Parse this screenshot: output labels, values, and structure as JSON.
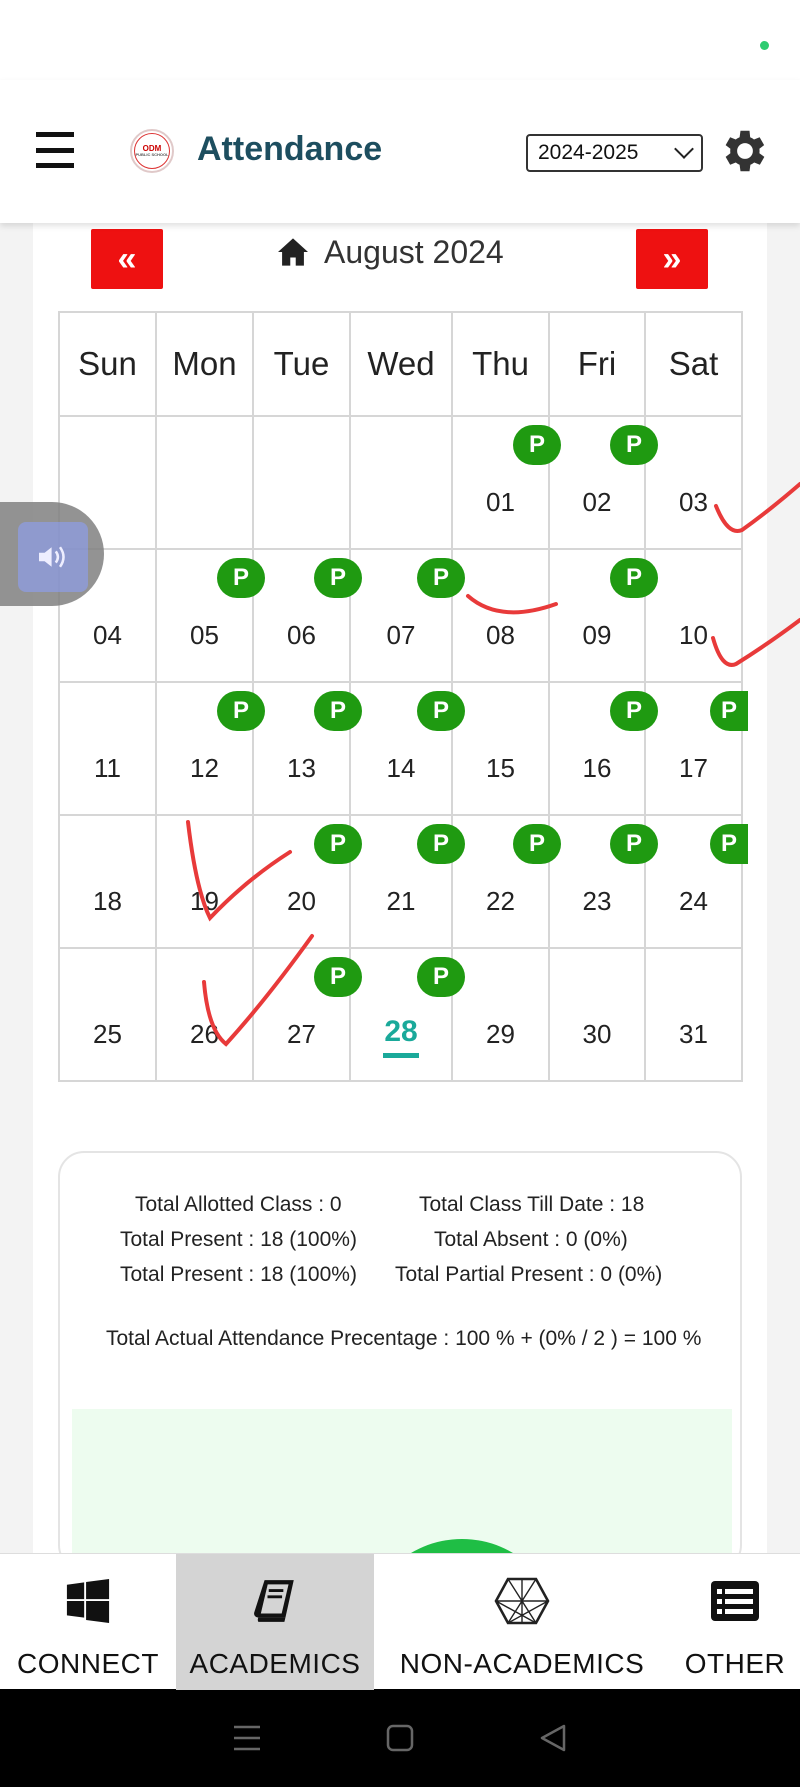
{
  "header": {
    "title": "Attendance",
    "year_selected": "2024-2025",
    "logo_text": "ODM",
    "logo_subtext": "PUBLIC SCHOOL"
  },
  "calendar": {
    "month_label": "August 2024",
    "prev_label": "«",
    "next_label": "»",
    "weekdays": [
      "Sun",
      "Mon",
      "Tue",
      "Wed",
      "Thu",
      "Fri",
      "Sat"
    ],
    "weeks": [
      [
        {
          "d": ""
        },
        {
          "d": ""
        },
        {
          "d": ""
        },
        {
          "d": ""
        },
        {
          "d": "01",
          "p": "P"
        },
        {
          "d": "02",
          "p": "P"
        },
        {
          "d": "03"
        }
      ],
      [
        {
          "d": "04"
        },
        {
          "d": "05",
          "p": "P"
        },
        {
          "d": "06",
          "p": "P"
        },
        {
          "d": "07",
          "p": "P"
        },
        {
          "d": "08"
        },
        {
          "d": "09",
          "p": "P"
        },
        {
          "d": "10"
        }
      ],
      [
        {
          "d": "11"
        },
        {
          "d": "12",
          "p": "P"
        },
        {
          "d": "13",
          "p": "P"
        },
        {
          "d": "14",
          "p": "P"
        },
        {
          "d": "15"
        },
        {
          "d": "16",
          "p": "P"
        },
        {
          "d": "17",
          "p": "P"
        }
      ],
      [
        {
          "d": "18"
        },
        {
          "d": "19"
        },
        {
          "d": "20",
          "p": "P"
        },
        {
          "d": "21",
          "p": "P"
        },
        {
          "d": "22",
          "p": "P"
        },
        {
          "d": "23",
          "p": "P"
        },
        {
          "d": "24",
          "p": "P"
        }
      ],
      [
        {
          "d": "25"
        },
        {
          "d": "26"
        },
        {
          "d": "27",
          "p": "P"
        },
        {
          "d": "28",
          "p": "P",
          "today": true
        },
        {
          "d": "29"
        },
        {
          "d": "30"
        },
        {
          "d": "31"
        }
      ]
    ]
  },
  "summary": {
    "total_allotted": "Total Allotted Class : 0",
    "total_till_date": "Total Class Till Date : 18",
    "total_present_1": "Total Present : 18 (100%)",
    "total_absent": "Total Absent : 0 (0%)",
    "total_present_2": "Total Present : 18 (100%)",
    "total_partial": "Total Partial Present : 0 (0%)",
    "actual_pct": "Total Actual Attendance Precentage : 100 % + (0% / 2 ) = 100 %"
  },
  "bottom_nav": {
    "connect": "CONNECT",
    "academics": "ACADEMICS",
    "non_academics": "NON-ACADEMICS",
    "other": "OTHER"
  },
  "colors": {
    "brand_title": "#1d4e5f",
    "nav_red": "#ee1111",
    "present_green": "#1f9a11",
    "today_teal": "#1aa99a",
    "ink_red": "#e83a3a"
  }
}
